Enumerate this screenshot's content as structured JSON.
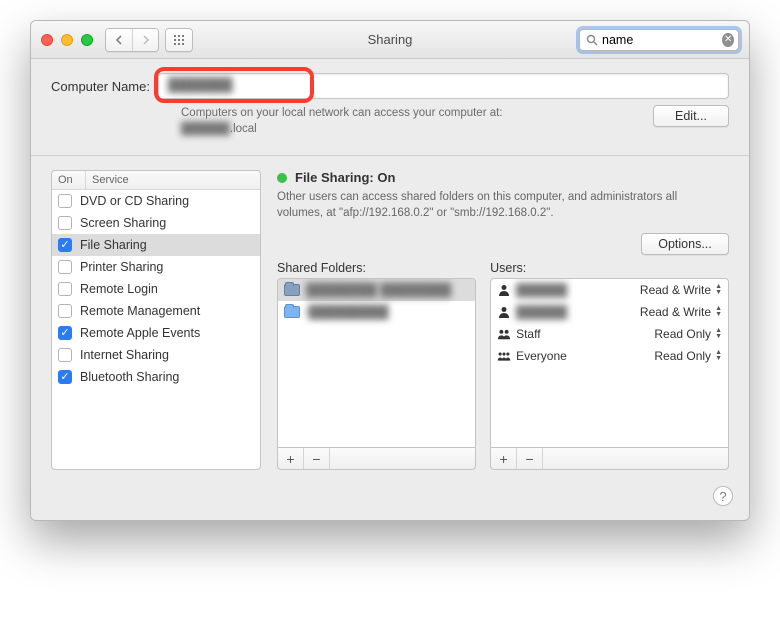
{
  "window": {
    "title": "Sharing"
  },
  "search": {
    "value": "name"
  },
  "computer_name": {
    "label": "Computer Name:",
    "value": "███████",
    "hint_line1": "Computers on your local network can access your computer at:",
    "hint_hostname": "██████",
    "hint_suffix": ".local",
    "edit_label": "Edit..."
  },
  "services": {
    "col_on": "On",
    "col_service": "Service",
    "items": [
      {
        "label": "DVD or CD Sharing",
        "on": false,
        "selected": false
      },
      {
        "label": "Screen Sharing",
        "on": false,
        "selected": false
      },
      {
        "label": "File Sharing",
        "on": true,
        "selected": true
      },
      {
        "label": "Printer Sharing",
        "on": false,
        "selected": false
      },
      {
        "label": "Remote Login",
        "on": false,
        "selected": false
      },
      {
        "label": "Remote Management",
        "on": false,
        "selected": false
      },
      {
        "label": "Remote Apple Events",
        "on": true,
        "selected": false
      },
      {
        "label": "Internet Sharing",
        "on": false,
        "selected": false
      },
      {
        "label": "Bluetooth Sharing",
        "on": true,
        "selected": false
      }
    ]
  },
  "status": {
    "title": "File Sharing: On",
    "desc": "Other users can access shared folders on this computer, and administrators all volumes, at \"afp://192.168.0.2\" or \"smb://192.168.0.2\".",
    "options_label": "Options..."
  },
  "shared_folders": {
    "label": "Shared Folders:",
    "items": [
      {
        "name": "████████ ████████",
        "selected": true,
        "kind": "public"
      },
      {
        "name": "i█████████",
        "selected": false,
        "kind": "folder"
      }
    ]
  },
  "users": {
    "label": "Users:",
    "items": [
      {
        "name": "██████",
        "perm": "Read & Write",
        "icon": "person"
      },
      {
        "name": "██████",
        "perm": "Read & Write",
        "icon": "person"
      },
      {
        "name": "Staff",
        "perm": "Read Only",
        "icon": "people"
      },
      {
        "name": "Everyone",
        "perm": "Read Only",
        "icon": "people3"
      }
    ]
  }
}
